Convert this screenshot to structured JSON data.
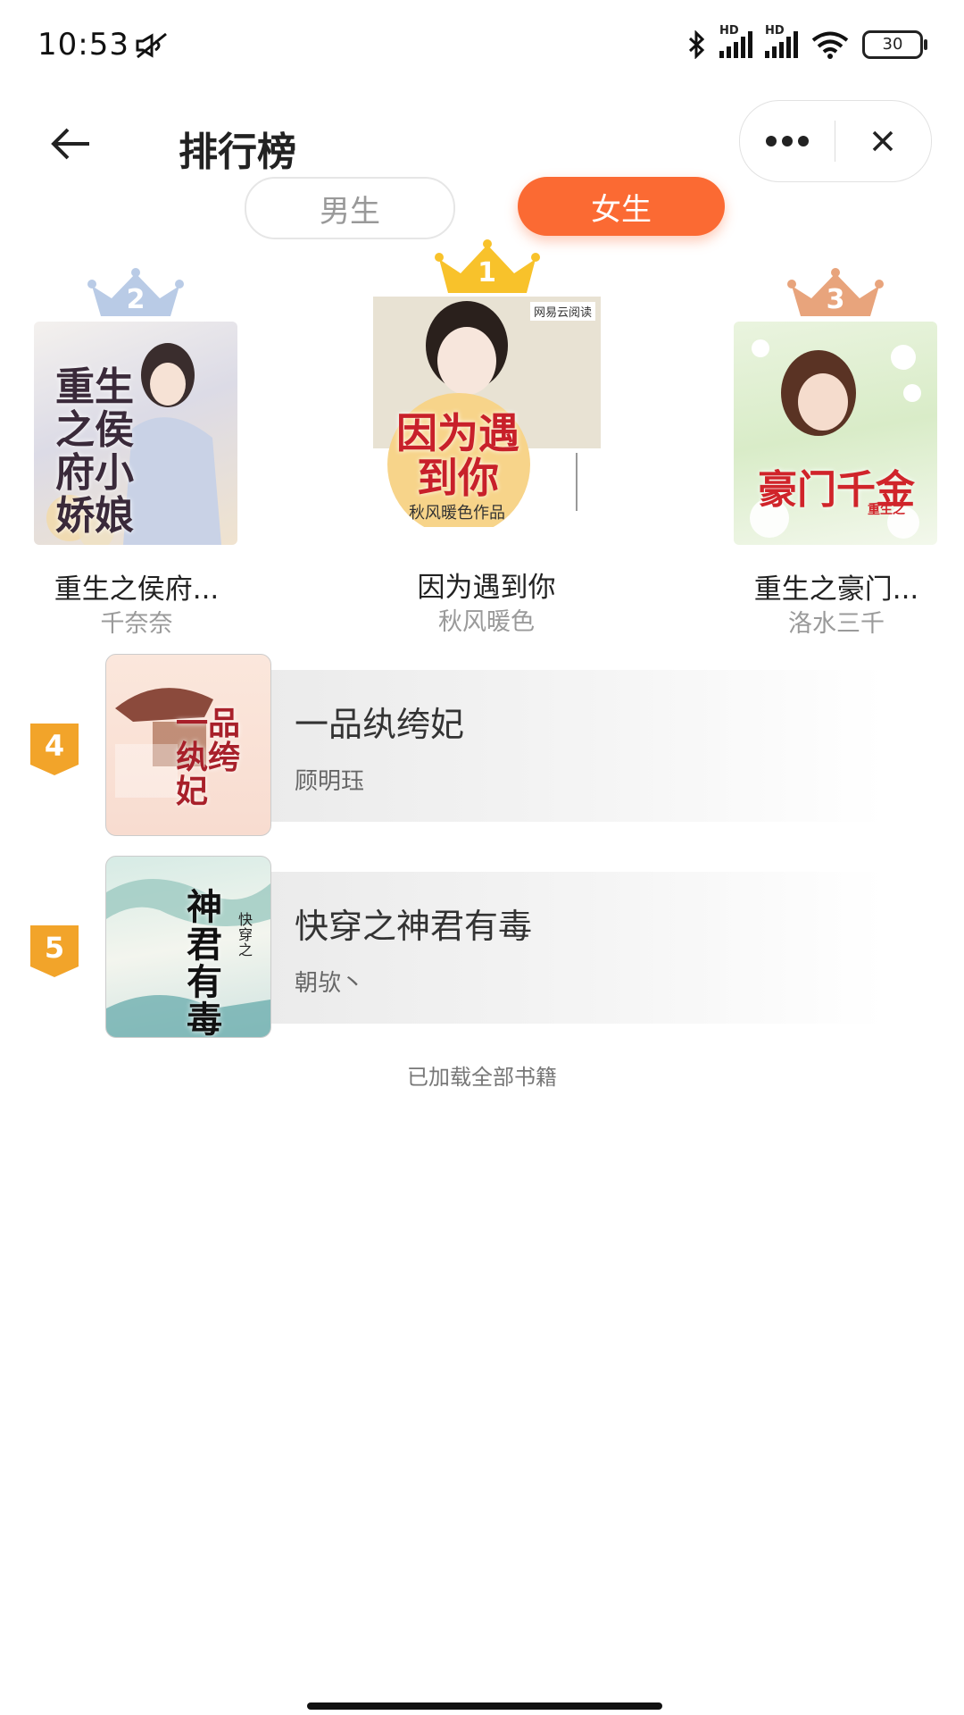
{
  "status_bar": {
    "time": "10:53",
    "battery": "30",
    "network": [
      "HD",
      "HD"
    ]
  },
  "header": {
    "title": "排行榜",
    "back_icon": "arrow-left-icon",
    "more_icon": "more-dots-icon",
    "close_icon": "close-icon"
  },
  "tabs": [
    {
      "label": "男生",
      "active": false
    },
    {
      "label": "女生",
      "active": true
    }
  ],
  "podium": [
    {
      "rank": "2",
      "title": "重生之侯府...",
      "author": "千奈奈",
      "cover_text": "重生之侯府小娇娘",
      "crown_color": "#b9cbe6"
    },
    {
      "rank": "1",
      "title": "因为遇到你",
      "author": "秋风暖色",
      "cover_text": "因为遇到你",
      "cover_sub": "秋风暖色作品",
      "cover_badge": "网易云阅读",
      "crown_color": "#f8c22b"
    },
    {
      "rank": "3",
      "title": "重生之豪门...",
      "author": "洛水三千",
      "cover_text": "豪门千金",
      "cover_sub": "重生之",
      "crown_color": "#e8a47c"
    }
  ],
  "list": [
    {
      "rank": "4",
      "title": "一品纨绔妃",
      "author": "顾明珏",
      "cover_text": "一品纨绔妃"
    },
    {
      "rank": "5",
      "title": "快穿之神君有毒",
      "author": "朝欤丶",
      "cover_text": "神君有毒",
      "cover_sub": "快穿之"
    }
  ],
  "footer": {
    "loaded_text": "已加载全部书籍"
  },
  "colors": {
    "accent": "#fb6a33",
    "rank_badge": "#f2a42a"
  }
}
